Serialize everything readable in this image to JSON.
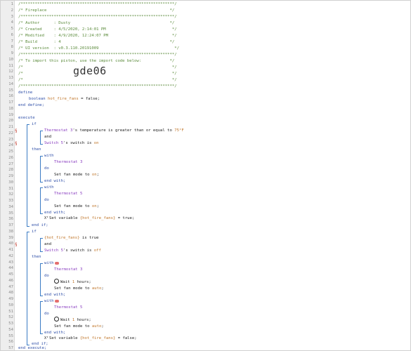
{
  "header": {
    "border": "/*****************************************************************/",
    "title": "/* Fireplace                                                    */",
    "author": "/* Author      : Dusty                                          */",
    "created": "/* Created     : 4/5/2020, 2:14:01 PM                            */",
    "modified": "/* Modified    : 4/9/2020, 12:24:07 PM                           */",
    "build": "/* Build       : 4                                              */",
    "ui_version": "/* UI version  : v0.3.110.20191009                                */",
    "import_text": "/* To import this piston, use the import code below:            */",
    "blank_a": "/*                                                               */",
    "blank_b": "/*                                                               */",
    "blank_c": "/*                                                               */",
    "import_code": "gde06"
  },
  "code": {
    "define": "define",
    "var_type": "boolean",
    "var_name": "hot_fire_fans",
    "var_assign": " = false;",
    "end_define": "end define;",
    "execute": "execute",
    "if": "if",
    "dev_thermostat3": "Thermostat 3",
    "dev_thermostat5": "Thermostat 5",
    "dev_switch5": "Switch 5",
    "cond1_mid": "'s temperature is greater than or equal to ",
    "cond1_val": "75°F",
    "and": "and",
    "cond2_mid": "'s switch is ",
    "on": "on",
    "off": "off",
    "then": "then",
    "with": "with",
    "do": "do",
    "set_fan_on_pre": "Set fan mode to ",
    "set_fan_on_val": "on",
    "end_with": "end with;",
    "set_variable_pre": "Set variable ",
    "set_variable_var": "{hot_fire_fans}",
    "set_true": " = true;",
    "set_false": " = false;",
    "end_if": "end if;",
    "var_ref": "{hot_fire_fans}",
    "is_true": " is true",
    "wait_pre": "Wait ",
    "wait_val": "1",
    "wait_post": " hours;",
    "auto": "auto",
    "semicolon": ";",
    "end_execute": "end execute;"
  },
  "line_numbers": [
    "1",
    "2",
    "3",
    "4",
    "5",
    "6",
    "7",
    "8",
    "9",
    "10",
    "11",
    "12",
    "13",
    "14",
    "15",
    "16",
    "17",
    "18",
    "19",
    "20",
    "21",
    "22",
    "23",
    "24",
    "25",
    "26",
    "27",
    "28",
    "29",
    "30",
    "31",
    "32",
    "33",
    "34",
    "35",
    "36",
    "37",
    "38",
    "39",
    "40",
    "41",
    "42",
    "43",
    "44",
    "45",
    "46",
    "47",
    "48",
    "49",
    "50",
    "51",
    "52",
    "53",
    "54",
    "55",
    "56",
    "57"
  ],
  "colors": {
    "comment": "#5a8a3a",
    "keyword": "#2f4fa8",
    "device": "#8a3fc0",
    "value": "#c0762a",
    "bracket": "#3b7cc4"
  }
}
